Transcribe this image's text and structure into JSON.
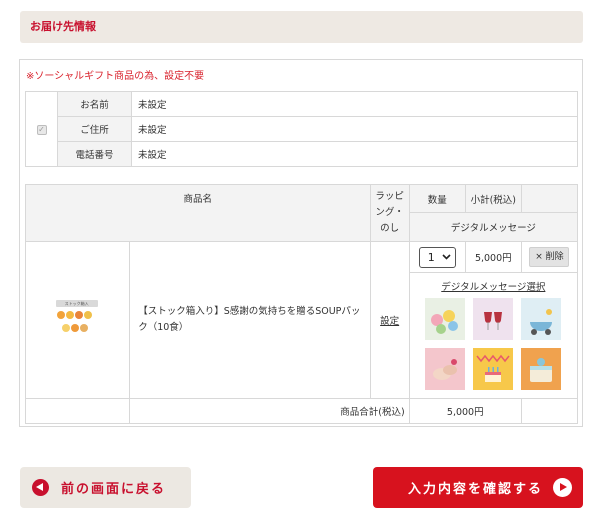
{
  "section": {
    "title": "お届け先情報"
  },
  "notice": "※ソーシャルギフト商品の為、設定不要",
  "recipient": {
    "rows": [
      {
        "label": "お名前",
        "value": "未設定"
      },
      {
        "label": "ご住所",
        "value": "未設定"
      },
      {
        "label": "電話番号",
        "value": "未設定"
      }
    ]
  },
  "items": {
    "headers": {
      "name": "商品名",
      "wrapping": "ラッピング・のし",
      "quantity": "数量",
      "subtotal": "小計(税込)",
      "digital_message": "デジタルメッセージ"
    },
    "product": {
      "stock_tag": "ストック箱入",
      "name": "【ストック箱入り】S感謝の気持ちを贈るSOUPパック（10食）",
      "wrapping_link": "設定",
      "quantity": "1",
      "subtotal": "5,000円",
      "delete_label": "× 削除",
      "message_link": "デジタルメッセージ選択"
    },
    "total": {
      "label": "商品合計(税込)",
      "value": "5,000円"
    }
  },
  "buttons": {
    "back": "前の画面に戻る",
    "confirm": "入力内容を確認する"
  },
  "colors": {
    "accent": "#d7121e",
    "header_bg": "#eee9e3",
    "notice": "#d9232d"
  }
}
